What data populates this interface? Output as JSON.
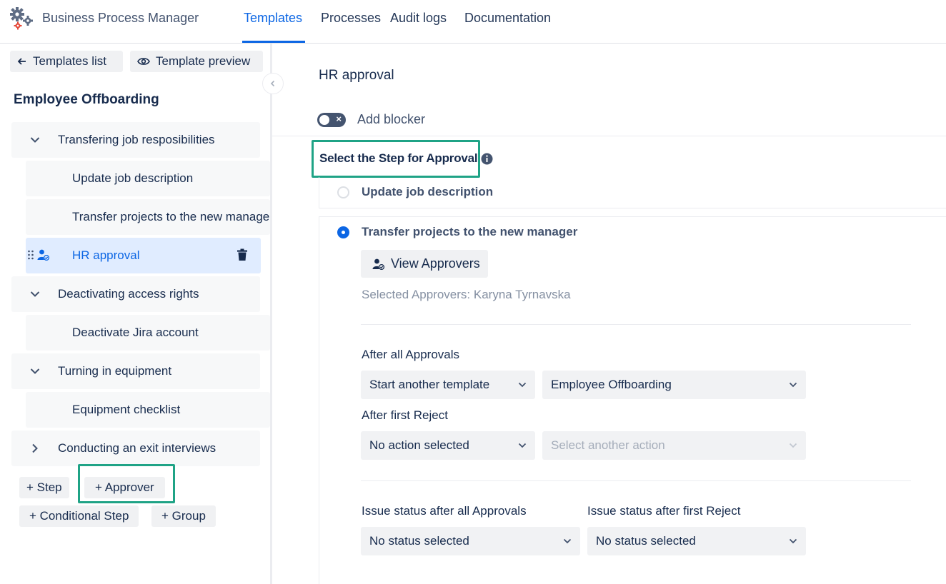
{
  "header": {
    "app_title": "Business Process Manager",
    "nav": [
      "Templates",
      "Processes",
      "Audit logs",
      "Documentation"
    ],
    "active_tab": "Templates"
  },
  "sidebar": {
    "templates_list_label": "Templates list",
    "template_preview_label": "Template preview",
    "template_name": "Employee Offboarding",
    "tree": {
      "group1": "Transfering job resposibilities",
      "step1": "Update job description",
      "step2": "Transfer projects to the new manager",
      "approval": "HR approval",
      "group2": "Deactivating access rights",
      "step3": "Deactivate Jira account",
      "group3": "Turning in equipment",
      "step4": "Equipment checklist",
      "group4": "Conducting an exit interviews"
    },
    "add_buttons": {
      "step": "+ Step",
      "approver": "+ Approver",
      "conditional_step": "+ Conditional Step",
      "group": "+ Group"
    }
  },
  "main": {
    "title": "HR approval",
    "add_blocker_label": "Add blocker",
    "select_step_label": "Select the Step for Approval",
    "options": {
      "option1": "Update job description",
      "option2": "Transfer projects to the new manager"
    },
    "selected_option": "Transfer projects to the new manager",
    "view_approvers_label": "View Approvers",
    "selected_approvers_text": "Selected Approvers: Karyna Tyrnavska",
    "after_all_approvals_label": "After all Approvals",
    "after_all_action": "Start another template",
    "after_all_template": "Employee Offboarding",
    "after_first_reject_label": "After first Reject",
    "after_reject_action": "No action selected",
    "after_reject_another_placeholder": "Select another action",
    "issue_status_after_all_label": "Issue status after all Approvals",
    "issue_status_after_all_value": "No status selected",
    "issue_status_after_reject_label": "Issue status after first Reject",
    "issue_status_after_reject_value": "No status selected"
  },
  "colors": {
    "accent": "#0c66e4",
    "highlight_box": "#1fa386",
    "selected_row": "#e0ecff"
  }
}
